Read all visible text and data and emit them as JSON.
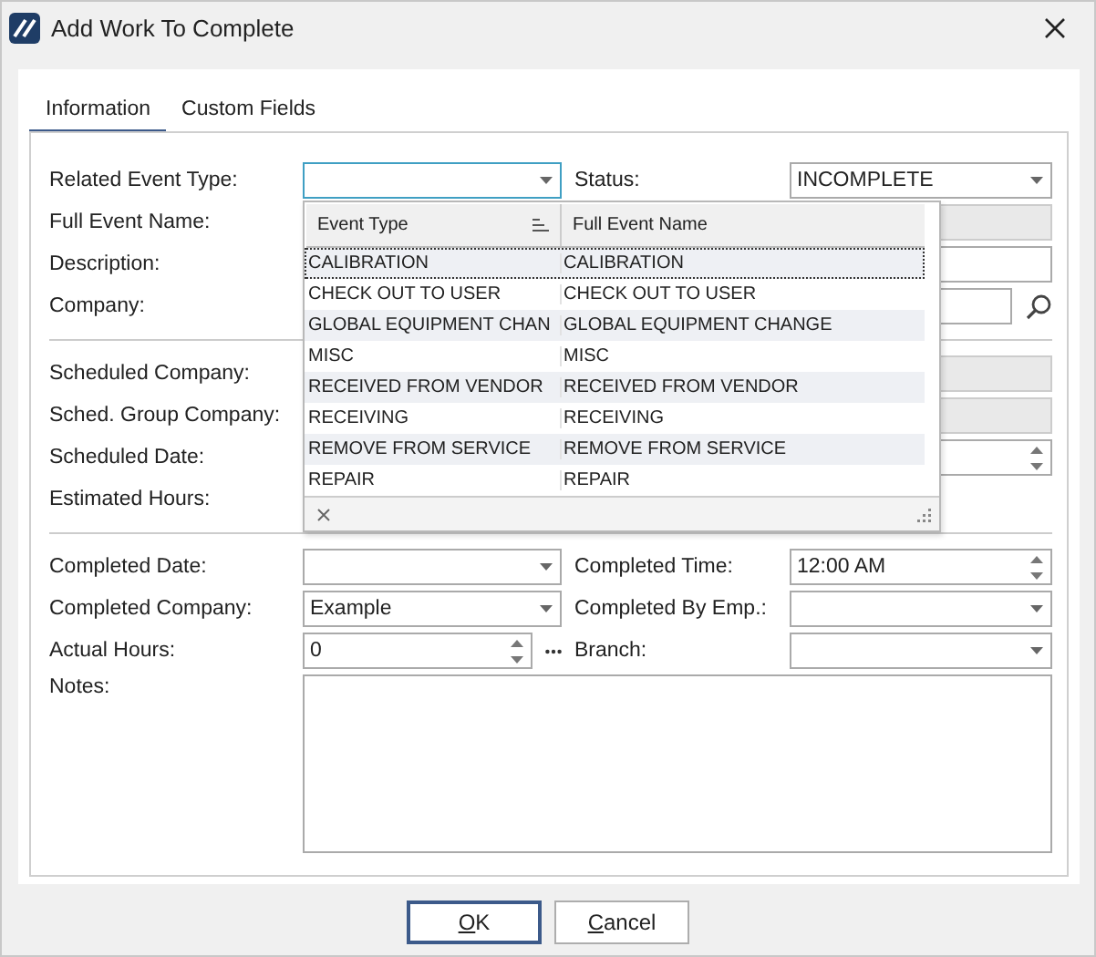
{
  "window": {
    "title": "Add Work To Complete"
  },
  "tabs": [
    {
      "label": "Information",
      "selected": true
    },
    {
      "label": "Custom Fields",
      "selected": false
    }
  ],
  "rows": [
    {
      "kind": "fields",
      "label": "Related Event Type:",
      "field": {
        "kind": "dropdown",
        "focused": true
      },
      "right": {
        "label": "Status:",
        "field": {
          "kind": "dropdown",
          "value": "INCOMPLETE"
        }
      }
    },
    {
      "kind": "fields",
      "label": "Full Event Name:",
      "field": {
        "kind": "text",
        "wide": true,
        "disabled": true
      }
    },
    {
      "kind": "fields",
      "label": "Description:",
      "field": {
        "kind": "text",
        "wide": true
      }
    },
    {
      "kind": "fields",
      "label": "Company:",
      "field": {
        "kind": "lookup",
        "wide": true
      }
    },
    {
      "kind": "divider"
    },
    {
      "kind": "fields",
      "label": "Scheduled Company:",
      "field": {
        "kind": "text",
        "wide": true,
        "disabled": true
      }
    },
    {
      "kind": "fields",
      "label": "Sched. Group Company:",
      "field": {
        "kind": "text",
        "wide": true,
        "disabled": true
      }
    },
    {
      "kind": "fields",
      "label": "Scheduled Date:",
      "right": {
        "field": {
          "kind": "spin"
        }
      }
    },
    {
      "kind": "fields",
      "label": "Estimated Hours:"
    },
    {
      "kind": "divider"
    },
    {
      "kind": "fields",
      "label": "Completed Date:",
      "field": {
        "kind": "dropdown"
      },
      "right": {
        "label": "Completed Time:",
        "field": {
          "kind": "spin",
          "value": "12:00 AM"
        }
      }
    },
    {
      "kind": "fields",
      "label": "Completed Company:",
      "field": {
        "kind": "dropdown",
        "value": "Example"
      },
      "right": {
        "label": "Completed By Emp.:",
        "field": {
          "kind": "dropdown"
        }
      }
    },
    {
      "kind": "fields",
      "label": "Actual Hours:",
      "field": {
        "kind": "spin_more",
        "value": "0"
      },
      "right": {
        "label": "Branch:",
        "field": {
          "kind": "dropdown"
        }
      }
    },
    {
      "kind": "notes",
      "label": "Notes:"
    }
  ],
  "dropdown": {
    "columns": [
      "Event Type",
      "Full Event Name"
    ],
    "rows": [
      {
        "cells": [
          "CALIBRATION",
          "CALIBRATION"
        ],
        "selected": true
      },
      {
        "cells": [
          "CHECK OUT TO USER",
          "CHECK OUT TO USER"
        ],
        "selected": false
      },
      {
        "cells": [
          "GLOBAL EQUIPMENT CHAN",
          "GLOBAL EQUIPMENT CHANGE"
        ],
        "selected": false
      },
      {
        "cells": [
          "MISC",
          "MISC"
        ],
        "selected": false
      },
      {
        "cells": [
          "RECEIVED FROM VENDOR",
          "RECEIVED FROM VENDOR"
        ],
        "selected": false
      },
      {
        "cells": [
          "RECEIVING",
          "RECEIVING"
        ],
        "selected": false
      },
      {
        "cells": [
          "REMOVE FROM SERVICE",
          "REMOVE FROM SERVICE"
        ],
        "selected": false
      },
      {
        "cells": [
          "REPAIR",
          "REPAIR"
        ],
        "selected": false
      }
    ]
  },
  "buttons": [
    {
      "label": "OK",
      "default": true
    },
    {
      "label": "Cancel",
      "default": false
    }
  ]
}
